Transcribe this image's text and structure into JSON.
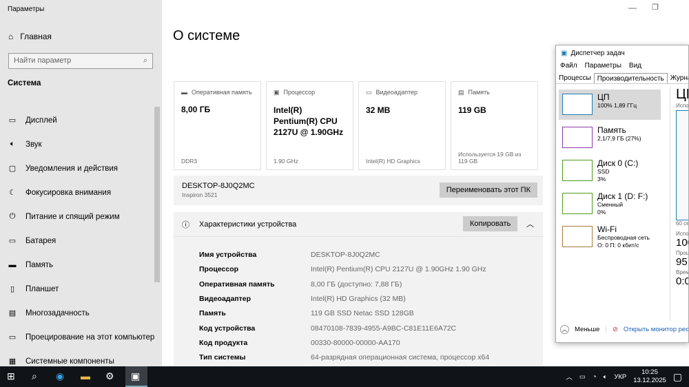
{
  "settings": {
    "title": "Параметры",
    "home": "Главная",
    "search_placeholder": "Найти параметр",
    "section": "Система",
    "nav": [
      {
        "icon": "display-icon",
        "label": "Дисплей"
      },
      {
        "icon": "sound-icon",
        "label": "Звук"
      },
      {
        "icon": "notifications-icon",
        "label": "Уведомления и действия"
      },
      {
        "icon": "focus-assist-icon",
        "label": "Фокусировка внимания"
      },
      {
        "icon": "power-icon",
        "label": "Питание и спящий режим"
      },
      {
        "icon": "battery-icon",
        "label": "Батарея"
      },
      {
        "icon": "storage-icon",
        "label": "Память"
      },
      {
        "icon": "tablet-icon",
        "label": "Планшет"
      },
      {
        "icon": "multitasking-icon",
        "label": "Многозадачность"
      },
      {
        "icon": "projecting-icon",
        "label": "Проецирование на этот компьютер"
      },
      {
        "icon": "components-icon",
        "label": "Системные компоненты"
      }
    ]
  },
  "main": {
    "title": "О системе",
    "cards": [
      {
        "label": "Оперативная память",
        "value": "8,00 ГБ",
        "sub": "DDR3"
      },
      {
        "label": "Процессор",
        "value": "Intel(R) Pentium(R) CPU 2127U @ 1.90GHz",
        "sub": "1.90 GHz"
      },
      {
        "label": "Видеоадаптер",
        "value": "32 MB",
        "sub": "Intel(R) HD Graphics"
      },
      {
        "label": "Память",
        "value": "119 GB",
        "sub": "Используется 19 GB из 119 GB"
      }
    ],
    "pc_name": "DESKTOP-8J0Q2MC",
    "pc_model": "Inspiron 3521",
    "rename": "Переименовать этот ПК",
    "specs_title": "Характеристики устройства",
    "copy": "Копировать",
    "specs": [
      {
        "k": "Имя устройства",
        "v": "DESKTOP-8J0Q2MC"
      },
      {
        "k": "Процессор",
        "v": "Intel(R) Pentium(R) CPU 2127U @ 1.90GHz   1.90 GHz"
      },
      {
        "k": "Оперативная память",
        "v": "8,00 ГБ (доступно: 7,88 ГБ)"
      },
      {
        "k": "Видеоадаптер",
        "v": "Intel(R) HD Graphics (32 MB)"
      },
      {
        "k": "Память",
        "v": "119 GB SSD Netac SSD 128GB"
      },
      {
        "k": "Код устройства",
        "v": "08470108-7839-4955-A9BC-C81E11E6A72C"
      },
      {
        "k": "Код продукта",
        "v": "00330-80000-00000-AA170"
      },
      {
        "k": "Тип системы",
        "v": "64-разрядная операционная система, процессор x64"
      }
    ]
  },
  "taskmgr": {
    "title": "Диспетчер задач",
    "menu": [
      "Файл",
      "Параметры",
      "Вид"
    ],
    "tabs": [
      "Процессы",
      "Производительность",
      "Журнал пр"
    ],
    "resources": [
      {
        "t": "ЦП",
        "s1": "100% 1,89 ГГц",
        "s2": "",
        "color": "#1c7ab0"
      },
      {
        "t": "Память",
        "s1": "2,1/7,9 ГБ (27%)",
        "s2": "",
        "color": "#8b3aa8"
      },
      {
        "t": "Диск 0 (C:)",
        "s1": "SSD",
        "s2": "3%",
        "color": "#4d9a1d"
      },
      {
        "t": "Диск 1 (D: F:)",
        "s1": "Сменный",
        "s2": "0%",
        "color": "#4d9a1d"
      },
      {
        "t": "Wi-Fi",
        "s1": "Беспроводная сеть",
        "s2": "О: 0 П: 0 кбит/с",
        "color": "#a77a3e"
      }
    ],
    "right": {
      "head": "ЦП",
      "usage_lbl": "Испо",
      "time_lbl": "60 се",
      "util_lbl": "Испо",
      "util": "100",
      "proc_lbl": "Проц",
      "proc": "95",
      "up_lbl": "Врем",
      "up": "0:0"
    },
    "less": "Меньше",
    "monitor": "Открыть монитор ресурсов"
  },
  "tray": {
    "lang": "УКР",
    "time": "10:25",
    "date": "13.12.2025"
  }
}
